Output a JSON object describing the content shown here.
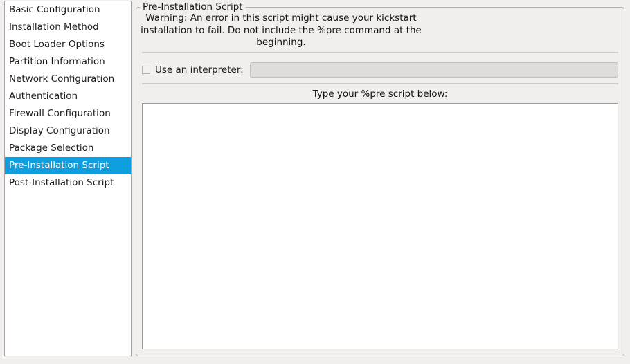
{
  "sidebar": {
    "items": [
      {
        "label": "Basic Configuration",
        "selected": false
      },
      {
        "label": "Installation Method",
        "selected": false
      },
      {
        "label": "Boot Loader Options",
        "selected": false
      },
      {
        "label": "Partition Information",
        "selected": false
      },
      {
        "label": "Network Configuration",
        "selected": false
      },
      {
        "label": "Authentication",
        "selected": false
      },
      {
        "label": "Firewall Configuration",
        "selected": false
      },
      {
        "label": "Display Configuration",
        "selected": false
      },
      {
        "label": "Package Selection",
        "selected": false
      },
      {
        "label": "Pre-Installation Script",
        "selected": true
      },
      {
        "label": "Post-Installation Script",
        "selected": false
      }
    ],
    "selected_label": "Pre-Installation Script",
    "selection_color": "#0f9fe0",
    "selection_text_color": "#ffffff"
  },
  "panel": {
    "title": "Pre-Installation Script",
    "warning": {
      "line1": "Warning: An error in this script might cause your kickstart",
      "line2": "installation to fail. Do not include the %pre command at the",
      "line3": "beginning."
    },
    "interpreter": {
      "checkbox_label": "Use an interpreter:",
      "checked": false,
      "value": "",
      "enabled": false
    },
    "script": {
      "label": "Type your %pre script below:",
      "value": "",
      "placeholder": ""
    }
  },
  "colors": {
    "window_background": "#f1efed",
    "list_background": "#ffffff",
    "frame_border": "#b6b2ae",
    "entry_disabled": "#dedbd8"
  }
}
